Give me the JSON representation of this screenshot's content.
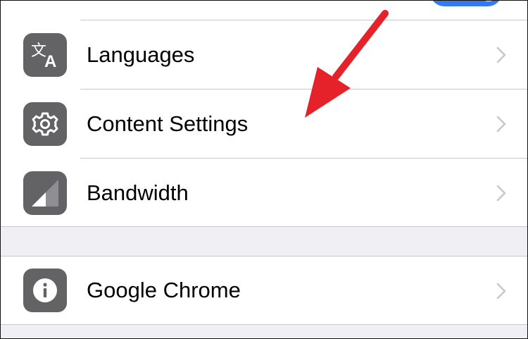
{
  "settings": {
    "items": [
      {
        "label": "Languages",
        "icon": "translate-icon"
      },
      {
        "label": "Content Settings",
        "icon": "gear-icon"
      },
      {
        "label": "Bandwidth",
        "icon": "signal-bars-icon"
      }
    ],
    "about_item": {
      "label": "Google Chrome",
      "icon": "info-icon"
    }
  },
  "colors": {
    "icon_tile": "#636366",
    "chevron": "#c7c7cc",
    "toggle_on": "#3478f6",
    "annotation_arrow": "#e5222a",
    "prev_icon_tile": "#f0883e"
  }
}
